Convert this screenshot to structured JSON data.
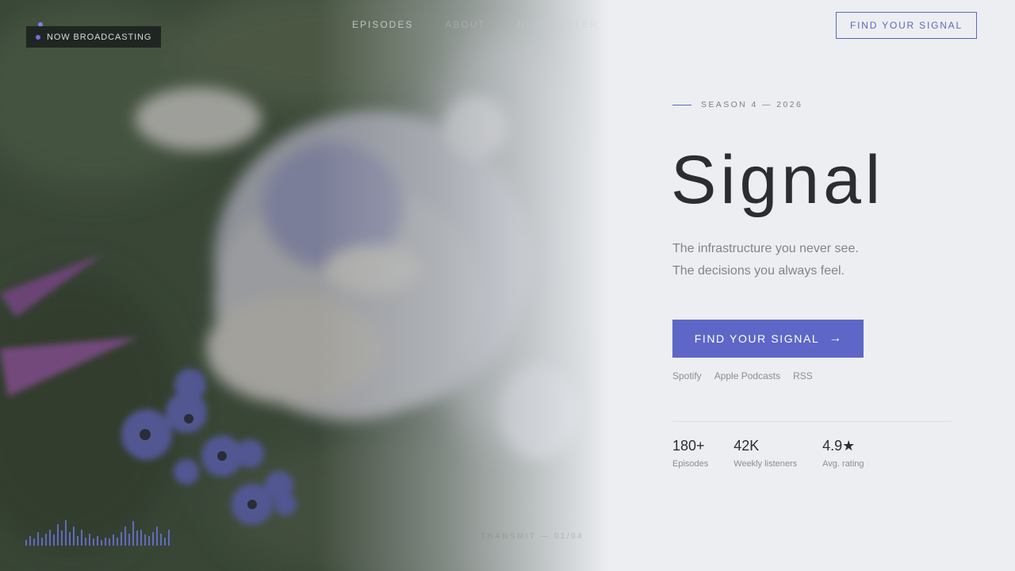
{
  "hero": {
    "badge_label": "NOW BROADCASTING",
    "caption": "TRANSMIT — 01/04",
    "nav": [
      {
        "label": "EPISODES"
      },
      {
        "label": "ABOUT"
      },
      {
        "label": "NEWSLETTER"
      }
    ],
    "waveform_levels": [
      0.2,
      0.35,
      0.25,
      0.5,
      0.3,
      0.45,
      0.6,
      0.4,
      0.8,
      0.55,
      0.95,
      0.5,
      0.7,
      0.35,
      0.6,
      0.3,
      0.45,
      0.25,
      0.35,
      0.2,
      0.3,
      0.25,
      0.4,
      0.3,
      0.5,
      0.7,
      0.45,
      0.9,
      0.55,
      0.6,
      0.4,
      0.35,
      0.5,
      0.7,
      0.45,
      0.3,
      0.6
    ]
  },
  "header": {
    "cta_label": "FIND YOUR SIGNAL"
  },
  "main": {
    "eyebrow": "SEASON 4 — 2026",
    "title": "Signal",
    "tagline_line1": "The infrastructure you never see.",
    "tagline_line2": "The decisions you always feel.",
    "cta_label": "FIND YOUR SIGNAL",
    "cta_icon": "arrow-right-icon",
    "cta_arrow": "→",
    "platforms": [
      {
        "label": "Spotify"
      },
      {
        "label": "Apple Podcasts"
      },
      {
        "label": "RSS"
      }
    ],
    "stats": [
      {
        "value": "180+",
        "label": "Episodes"
      },
      {
        "value": "42K",
        "label": "Weekly listeners"
      },
      {
        "value": "4.9★",
        "label": "Avg. rating"
      }
    ]
  },
  "colors": {
    "accent": "#5e67c7",
    "background": "#eceef1",
    "text_dark": "#2b2d31",
    "text_muted": "#80858d"
  }
}
